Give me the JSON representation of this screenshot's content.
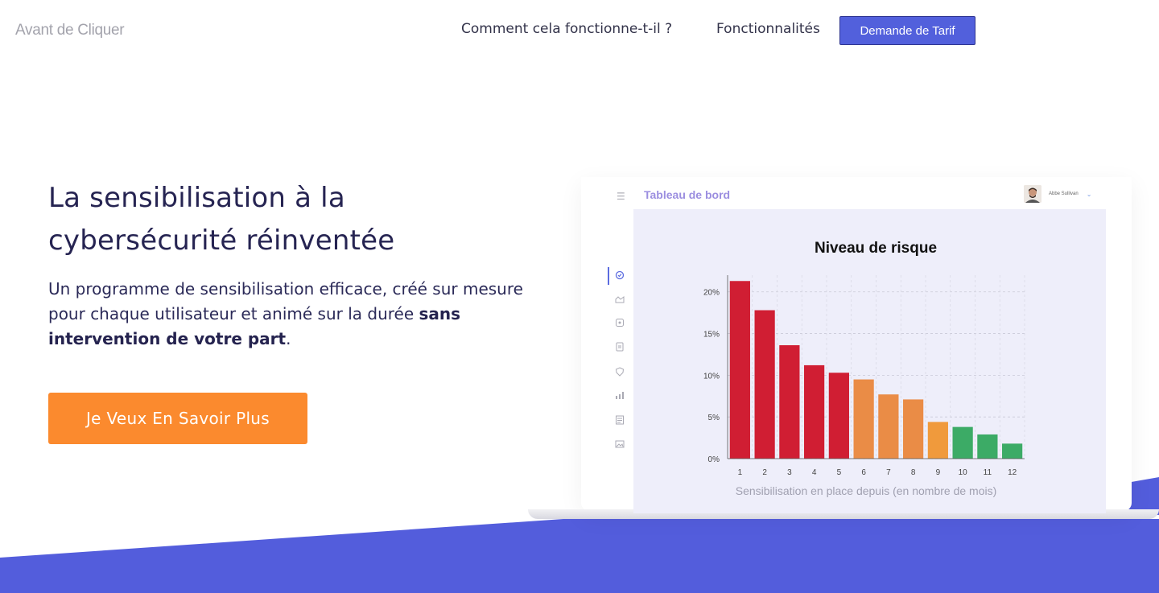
{
  "header": {
    "logo": "Avant de Cliquer",
    "nav": {
      "how": "Comment cela fonctionne-t-il ?",
      "features": "Fonctionnalités"
    },
    "cta": "Demande de Tarif"
  },
  "hero": {
    "title": "La sensibilisation à la cybersécurité réinventée",
    "subtitle": "Un programme de sensibilisation efficace, créé sur mesure pour chaque utilisateur et animé sur la durée",
    "subtitle_bold": "sans intervention de votre part",
    "subtitle_end": ".",
    "cta": "Je Veux En Savoir Plus"
  },
  "dashboard": {
    "title": "Tableau de bord",
    "user": "Abbe Sullivan",
    "menu_icons": [
      "menu-icon",
      "dashboard-icon",
      "chart-area-icon",
      "campaign-icon",
      "document-icon",
      "shield-icon",
      "stats-icon",
      "report-icon",
      "image-icon"
    ]
  },
  "colors": {
    "brand": "#5260dc",
    "cta_orange": "#fb8a2e",
    "risk_high": "#d01e33",
    "risk_medium": "#ea8c46",
    "risk_low": "#3cab66"
  },
  "chart_data": {
    "type": "bar",
    "title": "Niveau de risque",
    "xlabel": "Sensibilisation en place depuis (en nombre de mois)",
    "ylabel": "",
    "categories": [
      "1",
      "2",
      "3",
      "4",
      "5",
      "6",
      "7",
      "8",
      "9",
      "10",
      "11",
      "12"
    ],
    "values": [
      21.3,
      17.8,
      13.6,
      11.2,
      10.3,
      9.5,
      7.7,
      7.1,
      4.4,
      3.8,
      2.9,
      1.8
    ],
    "bar_colors": [
      "#d01e33",
      "#d01e33",
      "#d01e33",
      "#d01e33",
      "#d01e33",
      "#ea8c46",
      "#ea8c46",
      "#ea8c46",
      "#f09a3c",
      "#3cab66",
      "#3cab66",
      "#3cab66"
    ],
    "yticks": [
      "0%",
      "5%",
      "10%",
      "15%",
      "20%"
    ],
    "ylim": [
      0,
      22
    ],
    "grid": true
  }
}
